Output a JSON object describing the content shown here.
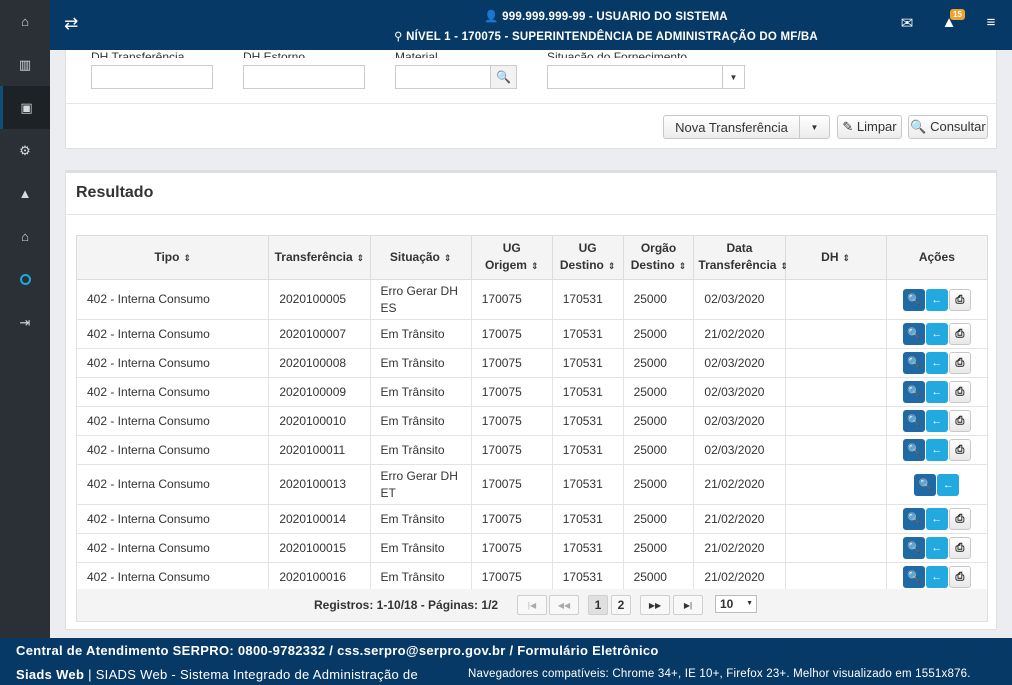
{
  "colors": {
    "navy": "#073966",
    "sidebar": "#2a3035",
    "view_btn": "#1f6aa5",
    "back_btn": "#22aae0",
    "badge": "#f0a22e"
  },
  "sidebar": {
    "items": [
      {
        "icon": "home-icon",
        "glyph": "⌂"
      },
      {
        "icon": "barcode-icon",
        "glyph": "▥"
      },
      {
        "icon": "archive-icon",
        "glyph": "▣"
      },
      {
        "icon": "gears-icon",
        "glyph": "⚙"
      },
      {
        "icon": "warning-icon",
        "glyph": "▲"
      },
      {
        "icon": "graduation-cap-icon",
        "glyph": "⌂"
      },
      {
        "icon": "circle-icon",
        "glyph": ""
      },
      {
        "icon": "sign-in-icon",
        "glyph": "⇥"
      }
    ]
  },
  "header": {
    "swap_glyph": "⇄",
    "user_line": "👤 999.999.999-99 - USUARIO DO SISTEMA",
    "level_line": "⚲ NÍVEL 1 - 170075 - SUPERINTENDÊNCIA DE ADMINISTRAÇÃO DO MF/BA",
    "mail_glyph": "✉",
    "alert_glyph": "▲",
    "alert_badge": "15",
    "menu_glyph": "≡"
  },
  "filters": {
    "labels": [
      "DH Transferência",
      "DH Estorno",
      "Material",
      "Situação do Fornecimento"
    ],
    "search_glyph": "🔍",
    "caret": "▼"
  },
  "buttons": {
    "nova_label": "Nova Transferência",
    "nova_caret": "▼",
    "limpar_label": "✎ Limpar",
    "consultar_label": "🔍 Consultar"
  },
  "result": {
    "title": "Resultado",
    "columns": [
      "Tipo",
      "Transferência",
      "Situação",
      "UG Origem",
      "UG Destino",
      "Orgão Destino",
      "Data Transferência",
      "DH",
      "Ações"
    ],
    "rows": [
      {
        "tipo": "402 - Interna Consumo",
        "transf": "2020100005",
        "situacao": "Erro Gerar DH ES",
        "ug_origem": "170075",
        "ug_destino": "170531",
        "orgao": "25000",
        "data": "02/03/2020",
        "dh": "",
        "print": true,
        "tall": true
      },
      {
        "tipo": "402 - Interna Consumo",
        "transf": "2020100007",
        "situacao": "Em Trânsito",
        "ug_origem": "170075",
        "ug_destino": "170531",
        "orgao": "25000",
        "data": "21/02/2020",
        "dh": "",
        "print": true,
        "tall": false
      },
      {
        "tipo": "402 - Interna Consumo",
        "transf": "2020100008",
        "situacao": "Em Trânsito",
        "ug_origem": "170075",
        "ug_destino": "170531",
        "orgao": "25000",
        "data": "02/03/2020",
        "dh": "",
        "print": true,
        "tall": false
      },
      {
        "tipo": "402 - Interna Consumo",
        "transf": "2020100009",
        "situacao": "Em Trânsito",
        "ug_origem": "170075",
        "ug_destino": "170531",
        "orgao": "25000",
        "data": "02/03/2020",
        "dh": "",
        "print": true,
        "tall": false
      },
      {
        "tipo": "402 - Interna Consumo",
        "transf": "2020100010",
        "situacao": "Em Trânsito",
        "ug_origem": "170075",
        "ug_destino": "170531",
        "orgao": "25000",
        "data": "02/03/2020",
        "dh": "",
        "print": true,
        "tall": false
      },
      {
        "tipo": "402 - Interna Consumo",
        "transf": "2020100011",
        "situacao": "Em Trânsito",
        "ug_origem": "170075",
        "ug_destino": "170531",
        "orgao": "25000",
        "data": "02/03/2020",
        "dh": "",
        "print": true,
        "tall": false
      },
      {
        "tipo": "402 - Interna Consumo",
        "transf": "2020100013",
        "situacao": "Erro Gerar DH ET",
        "ug_origem": "170075",
        "ug_destino": "170531",
        "orgao": "25000",
        "data": "21/02/2020",
        "dh": "",
        "print": false,
        "tall": true
      },
      {
        "tipo": "402 - Interna Consumo",
        "transf": "2020100014",
        "situacao": "Em Trânsito",
        "ug_origem": "170075",
        "ug_destino": "170531",
        "orgao": "25000",
        "data": "21/02/2020",
        "dh": "",
        "print": true,
        "tall": false
      },
      {
        "tipo": "402 - Interna Consumo",
        "transf": "2020100015",
        "situacao": "Em Trânsito",
        "ug_origem": "170075",
        "ug_destino": "170531",
        "orgao": "25000",
        "data": "21/02/2020",
        "dh": "",
        "print": true,
        "tall": false
      },
      {
        "tipo": "402 - Interna Consumo",
        "transf": "2020100016",
        "situacao": "Em Trânsito",
        "ug_origem": "170075",
        "ug_destino": "170531",
        "orgao": "25000",
        "data": "21/02/2020",
        "dh": "",
        "print": true,
        "tall": false
      }
    ],
    "action_glyphs": {
      "view": "🔍",
      "back": "←",
      "print": "⎙"
    }
  },
  "pager": {
    "info": "Registros: 1-10/18 - Páginas: 1/2",
    "first": "|◀",
    "prev": "◀◀",
    "pages": [
      "1",
      "2"
    ],
    "next": "▶▶",
    "last": "▶|",
    "page_size": "10",
    "page_size_caret": "▼"
  },
  "footer": {
    "line1": "Central de Atendimento SERPRO: 0800-9782332 / css.serpro@serpro.gov.br / Formulário Eletrônico",
    "brand": "Siads Web",
    "system": " | SIADS Web - Sistema Integrado de Administração de",
    "browsers": "Navegadores compatíveis: Chrome 34+, IE 10+, Firefox 23+. Melhor visualizado em 1551x876."
  }
}
